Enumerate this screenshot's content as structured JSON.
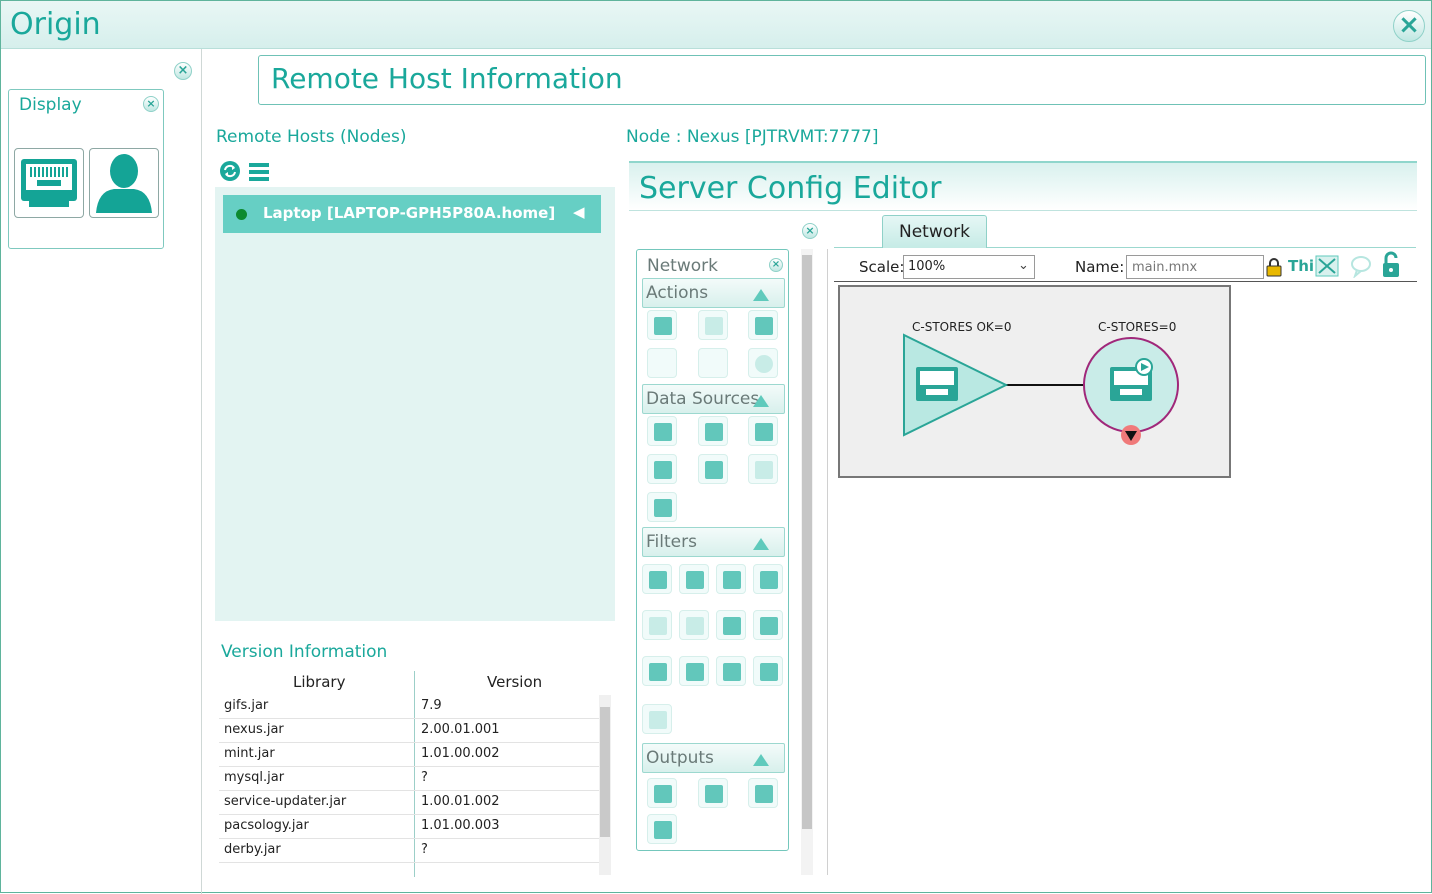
{
  "app": {
    "title": "Origin"
  },
  "display_panel": {
    "title": "Display"
  },
  "header": {
    "title": "Remote Host Information"
  },
  "remote_hosts": {
    "title": "Remote Hosts (Nodes)",
    "hosts": [
      {
        "label": "Laptop [LAPTOP-GPH5P80A.home]",
        "status_color": "#0c8a2f"
      }
    ]
  },
  "version_info": {
    "title": "Version Information",
    "columns": [
      "Library",
      "Version"
    ],
    "rows": [
      [
        "gifs.jar",
        "7.9"
      ],
      [
        "nexus.jar",
        "2.00.01.001"
      ],
      [
        "mint.jar",
        "1.01.00.002"
      ],
      [
        "mysql.jar",
        "?"
      ],
      [
        "service-updater.jar",
        "1.00.01.002"
      ],
      [
        "pacsology.jar",
        "1.01.00.003"
      ],
      [
        "derby.jar",
        "?"
      ]
    ]
  },
  "node": {
    "label": "Node : Nexus [PJTRVMT:7777]"
  },
  "server_config": {
    "title": "Server Config Editor",
    "palette": {
      "title": "Network",
      "sections": [
        "Actions",
        "Data Sources",
        "Filters",
        "Outputs"
      ]
    },
    "tab": "Network",
    "scale_label": "Scale:",
    "scale_value": "100%",
    "name_label": "Name:",
    "name_value": "main.mnx",
    "truncated_label": "Thi",
    "nodes": [
      {
        "label": "C-STORES OK=0",
        "shape": "triangle"
      },
      {
        "label": "C-STORES=0",
        "shape": "circle"
      }
    ]
  },
  "colors": {
    "accent": "#1aa89b",
    "tool": "#62c7bb",
    "node_border": "#a0287a",
    "status_red": "#f07a7a"
  }
}
